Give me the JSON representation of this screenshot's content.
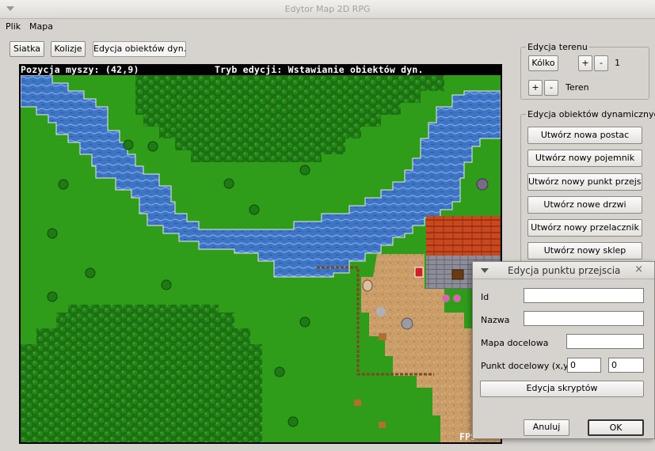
{
  "window": {
    "title": "Edytor Map 2D RPG"
  },
  "menu": {
    "items": [
      "Plik",
      "Mapa"
    ]
  },
  "toolbar": {
    "grid_label": "Siatka",
    "collisions_label": "Kolizje",
    "dyn_objects_label": "Edycja obiektów dyn."
  },
  "map_view": {
    "mouse_position": "Pozycja myszy: (42,9)",
    "edit_mode": "Tryb edycji: Wstawianie obiektów dyn.",
    "fps": "FPS"
  },
  "terrain_panel": {
    "legend": "Edycja terenu",
    "brush_button": "Kólko",
    "plus": "+",
    "minus": "-",
    "brush_size": "1",
    "terrain_label": "Teren"
  },
  "dyn_panel": {
    "legend": "Edycja obiektów dynamicznych",
    "buttons": [
      "Utwórz nowa postac",
      "Utwórz nowy pojemnik",
      "Utwórz nowy punkt przejscia",
      "Utwórz nowe drzwi",
      "Utwórz nowy przelacznik",
      "Utwórz nowy sklep"
    ]
  },
  "dialog": {
    "title": "Edycja punktu przejscia",
    "close": "×",
    "id_label": "Id",
    "id_value": "",
    "name_label": "Nazwa",
    "name_value": "",
    "target_map_label": "Mapa docelowa",
    "target_map_value": "",
    "target_point_label": "Punkt docelowy (x,y)",
    "target_x": "0",
    "target_y": "0",
    "scripts_button": "Edycja skryptów",
    "cancel_button": "Anuluj",
    "ok_button": "OK"
  },
  "colors": {
    "grass": "#2e9a18",
    "forest": "#1f7a12",
    "water": "#3f78c8",
    "dirt": "#c9a070",
    "roof": "#c8481c",
    "wall": "#8a8a96"
  }
}
